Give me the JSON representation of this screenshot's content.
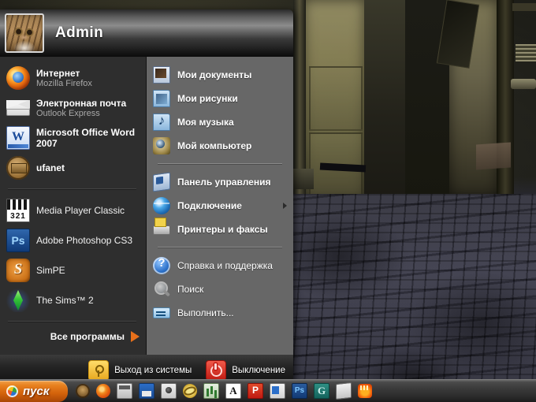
{
  "desktop": {
    "wallpaper_description": "dark abandoned industrial room with lit wooden door and cracked concrete floor",
    "wallpaper_colors": {
      "wall_lit": "#8b8458",
      "wall_dark": "#23231d",
      "floor": "#363645"
    }
  },
  "start_menu": {
    "header": {
      "user_name": "Admin",
      "avatar_icon": "cat-avatar-icon"
    },
    "left_column": {
      "pinned": [
        {
          "title": "Интернет",
          "subtitle": "Mozilla Firefox",
          "icon": "firefox-icon"
        },
        {
          "title": "Электронная почта",
          "subtitle": "Outlook Express",
          "icon": "mail-icon"
        },
        {
          "title": "Microsoft Office Word 2007",
          "subtitle": "",
          "icon": "word-icon"
        },
        {
          "title": "ufanet",
          "subtitle": "",
          "icon": "ufanet-icon"
        }
      ],
      "recent": [
        {
          "title": "Media Player Classic",
          "icon": "media-player-classic-icon"
        },
        {
          "title": "Adobe Photoshop CS3",
          "icon": "photoshop-icon"
        },
        {
          "title": "SimPE",
          "icon": "simpe-icon"
        },
        {
          "title": "The Sims™ 2",
          "icon": "the-sims-2-icon"
        }
      ],
      "all_programs_label": "Все программы",
      "all_programs_arrow_color": "#e8701a"
    },
    "right_column": {
      "group_places": [
        {
          "label": "Мои документы",
          "icon": "my-documents-icon"
        },
        {
          "label": "Мои рисунки",
          "icon": "my-pictures-icon"
        },
        {
          "label": "Моя музыка",
          "icon": "my-music-icon"
        },
        {
          "label": "Мой компьютер",
          "icon": "my-computer-icon"
        }
      ],
      "group_system": [
        {
          "label": "Панель управления",
          "icon": "control-panel-icon",
          "has_submenu": false
        },
        {
          "label": "Подключение",
          "icon": "network-globe-icon",
          "has_submenu": true
        },
        {
          "label": "Принтеры и факсы",
          "icon": "printers-and-faxes-icon",
          "has_submenu": false
        }
      ],
      "group_tools": [
        {
          "label": "Справка и поддержка",
          "icon": "help-icon"
        },
        {
          "label": "Поиск",
          "icon": "search-icon"
        },
        {
          "label": "Выполнить...",
          "icon": "run-icon"
        }
      ]
    },
    "bottom_bar": {
      "log_off_label": "Выход из системы",
      "log_off_icon": "log-off-key-icon",
      "shutdown_label": "Выключение",
      "shutdown_icon": "shutdown-power-icon"
    }
  },
  "taskbar": {
    "start_button_label": "пуск",
    "start_button_icon": "windows-flag-icon",
    "start_button_color": "#e8811f",
    "quick_launch": [
      {
        "icon": "ufanet-icon"
      },
      {
        "icon": "firefox-icon"
      },
      {
        "icon": "calculator-icon"
      },
      {
        "icon": "floppy-save-icon"
      },
      {
        "icon": "camera-icon"
      },
      {
        "icon": "opera-icon"
      },
      {
        "icon": "chart-icon"
      },
      {
        "icon": "abbyy-finereader-icon"
      },
      {
        "icon": "powerpoint-icon"
      },
      {
        "icon": "document-icon"
      },
      {
        "icon": "photoshop-icon"
      },
      {
        "icon": "spiral-green-icon"
      },
      {
        "icon": "white-box-icon"
      },
      {
        "icon": "orange-hand-icon"
      }
    ]
  }
}
